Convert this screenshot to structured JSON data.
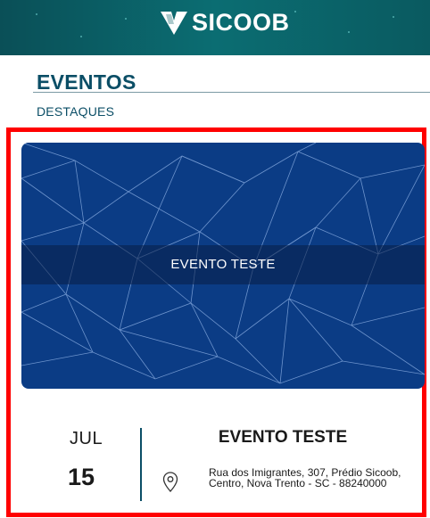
{
  "header": {
    "brand": "SICOOB",
    "logo_icon": "sicoob-logo-icon",
    "bg_color": "#0b6068"
  },
  "section": {
    "title": "EVENTOS",
    "subtitle": "DESTAQUES",
    "color": "#0b4e66"
  },
  "event": {
    "banner_title": "EVENTO TESTE",
    "month": "JUL",
    "day": "15",
    "title": "EVENTO TESTE",
    "location_icon": "location-pin-icon",
    "address": "Rua dos Imigrantes, 307, Prédio Sicoob, Centro, Nova Trento - SC - 88240000",
    "banner_color": "#0b3c85",
    "highlight_border_color": "#ff0000"
  }
}
